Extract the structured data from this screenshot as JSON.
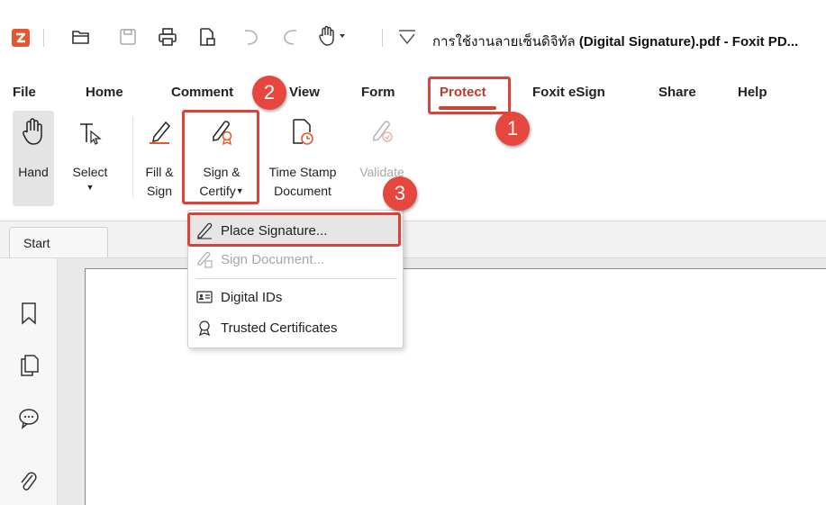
{
  "window": {
    "title_thai": "การใช้งานลายเซ็นดิจิทัล",
    "title_rest": " (Digital Signature).pdf - Foxit PD...",
    "quick_access_icons": [
      "foxit-logo-icon",
      "open-folder-icon",
      "save-icon",
      "print-icon",
      "create-icon",
      "undo-icon",
      "redo-icon",
      "hand-mode-icon",
      "customize-dropdown-icon"
    ],
    "accent": "#c8452f"
  },
  "menu_tabs": [
    {
      "label": "File"
    },
    {
      "label": "Home"
    },
    {
      "label": "Comment"
    },
    {
      "label": "View"
    },
    {
      "label": "Form"
    },
    {
      "label": "Protect",
      "active": true
    },
    {
      "label": "Foxit eSign"
    },
    {
      "label": "Share"
    },
    {
      "label": "Help"
    }
  ],
  "ribbon": {
    "hand": "Hand",
    "select": "Select",
    "fill_sign_1": "Fill &",
    "fill_sign_2": "Sign",
    "sign_certify_1": "Sign &",
    "sign_certify_2": "Certify",
    "time_stamp_1": "Time Stamp",
    "time_stamp_2": "Document",
    "validate": "Validate"
  },
  "doc_tab": {
    "label": "Start"
  },
  "dropdown": {
    "place_signature": "Place Signature...",
    "sign_document": "Sign Document...",
    "digital_ids": "Digital IDs",
    "trusted_certificates": "Trusted Certificates"
  },
  "sidebar_icons": [
    "bookmark-icon",
    "pages-icon",
    "comments-icon",
    "attachment-icon"
  ],
  "annotations": {
    "badge_1": "1",
    "badge_2": "2",
    "badge_3": "3",
    "color": "#e5473f"
  }
}
